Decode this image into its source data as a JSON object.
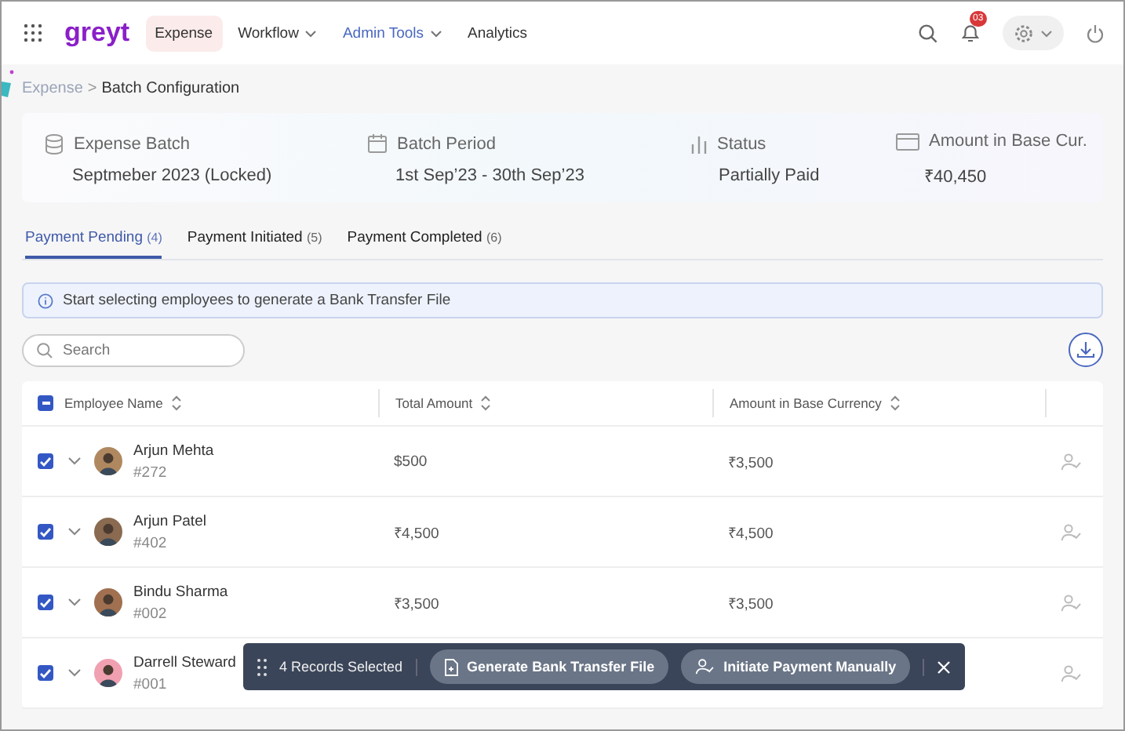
{
  "nav": {
    "logo": "greyt",
    "items": [
      {
        "label": "Expense",
        "selected": true,
        "highlighted": false,
        "dropdown": false
      },
      {
        "label": "Workflow",
        "selected": false,
        "highlighted": false,
        "dropdown": true
      },
      {
        "label": "Admin Tools",
        "selected": false,
        "highlighted": true,
        "dropdown": true
      },
      {
        "label": "Analytics",
        "selected": false,
        "highlighted": false,
        "dropdown": false
      }
    ],
    "notification_count": "03"
  },
  "breadcrumb": [
    "Expense",
    ">",
    "Batch Configuration"
  ],
  "summary": [
    {
      "kind": "batch",
      "label": "Expense Batch",
      "value": "Septmeber 2023 (Locked)"
    },
    {
      "kind": "period",
      "label": "Batch Period",
      "value": "1st Sep’23 - 30th Sep’23"
    },
    {
      "kind": "status",
      "label": "Status",
      "value": "Partially Paid"
    },
    {
      "kind": "amount",
      "label": "Amount in Base Cur.",
      "value": "₹40,450"
    }
  ],
  "tabs": [
    {
      "label": "Payment Pending",
      "count": "(4)",
      "selected": true
    },
    {
      "label": "Payment Initiated",
      "count": "(5)",
      "selected": false
    },
    {
      "label": "Payment Completed",
      "count": "(6)",
      "selected": false
    }
  ],
  "info": "Start selecting employees to generate a Bank Transfer File",
  "search": {
    "placeholder": "Search"
  },
  "table": {
    "columns": [
      "Employee Name",
      "Total Amount",
      "Amount in Base Currency"
    ],
    "all_partial": true,
    "rows": [
      {
        "name": "Arjun Mehta",
        "id": "#272",
        "total": "$500",
        "base": "₹3,500",
        "checked": true
      },
      {
        "name": "Arjun Patel",
        "id": "#402",
        "total": "₹4,500",
        "base": "₹4,500",
        "checked": true
      },
      {
        "name": "Bindu Sharma",
        "id": "#002",
        "total": "₹3,500",
        "base": "₹3,500",
        "checked": true
      },
      {
        "name": "Darrell Steward",
        "id": "#001",
        "checked": true
      }
    ]
  },
  "action_bar": {
    "count": "4 Records Selected",
    "buttons": [
      "Generate Bank Transfer File",
      "Initiate Payment Manually"
    ]
  }
}
